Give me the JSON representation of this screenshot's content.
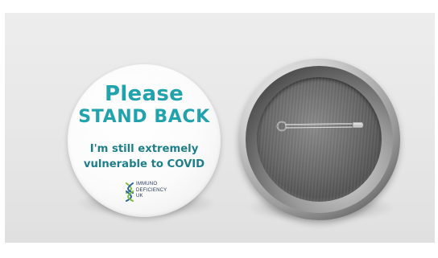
{
  "badge_front": {
    "line1": "Please",
    "line2": "STAND BACK",
    "line3": "I'm still extremely",
    "line4": "vulnerable to COVID",
    "logo": {
      "text_line1": "IMMUNO",
      "text_line2": "DEFICIENCY",
      "text_line3": "UK",
      "icon": "dna-helix-icon"
    }
  },
  "badge_back": {
    "features": [
      "metal-rim",
      "brushed-metal-disc",
      "safety-pin"
    ]
  },
  "colors": {
    "teal": "#21a3ad",
    "dark_teal": "#1d7f8a",
    "logo_green": "#7bbf3a",
    "logo_blue": "#2a62a8",
    "logo_text": "#1f3556",
    "background": "#e6e6e6"
  }
}
